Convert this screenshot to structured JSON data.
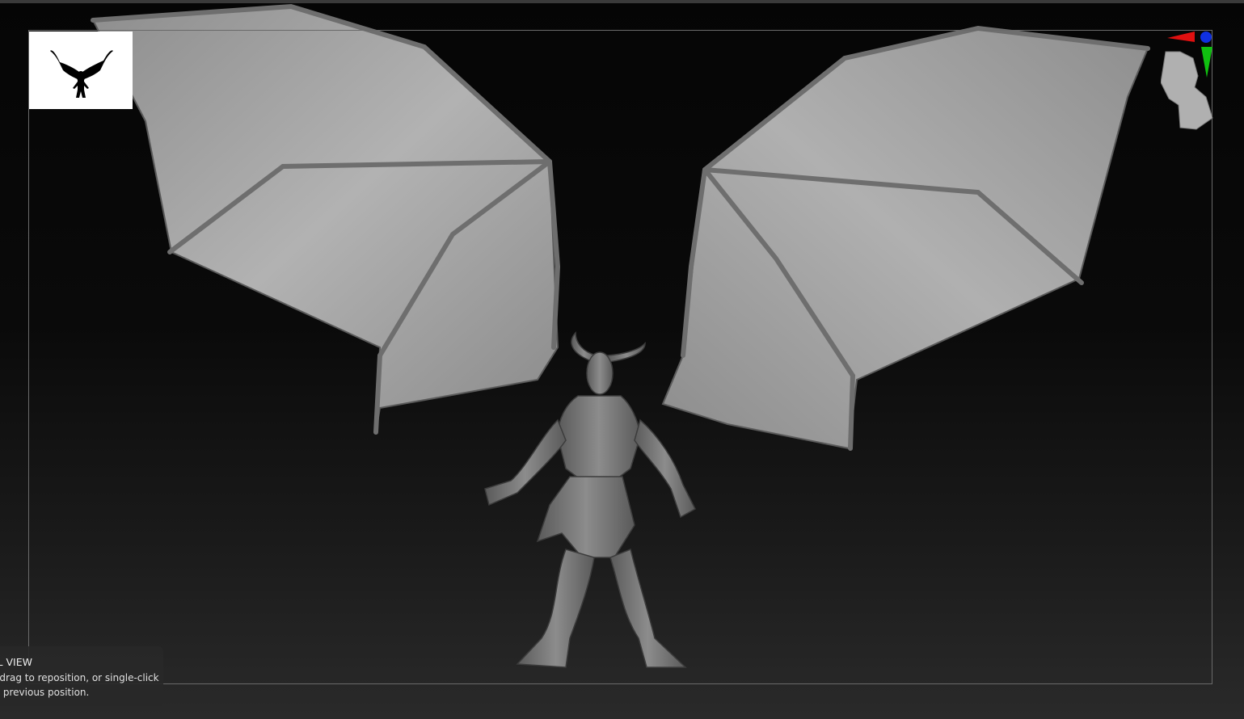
{
  "viewport": {
    "model": "winged-demon-sculpt",
    "background_top": "#050505",
    "background_bottom": "#2a2a2a",
    "frame_color": "#6a6a6a"
  },
  "thumbnail": {
    "icon": "demon-silhouette-icon",
    "background": "#ffffff"
  },
  "gizmo": {
    "icon": "head-orientation-gizmo-icon",
    "axis_colors": {
      "x": "#e01010",
      "y": "#10c010",
      "z": "#1030e0"
    }
  },
  "tooltip": {
    "title": "AL VIEW",
    "line1": "d drag to reposition, or single-click",
    "line2": "re previous position."
  }
}
